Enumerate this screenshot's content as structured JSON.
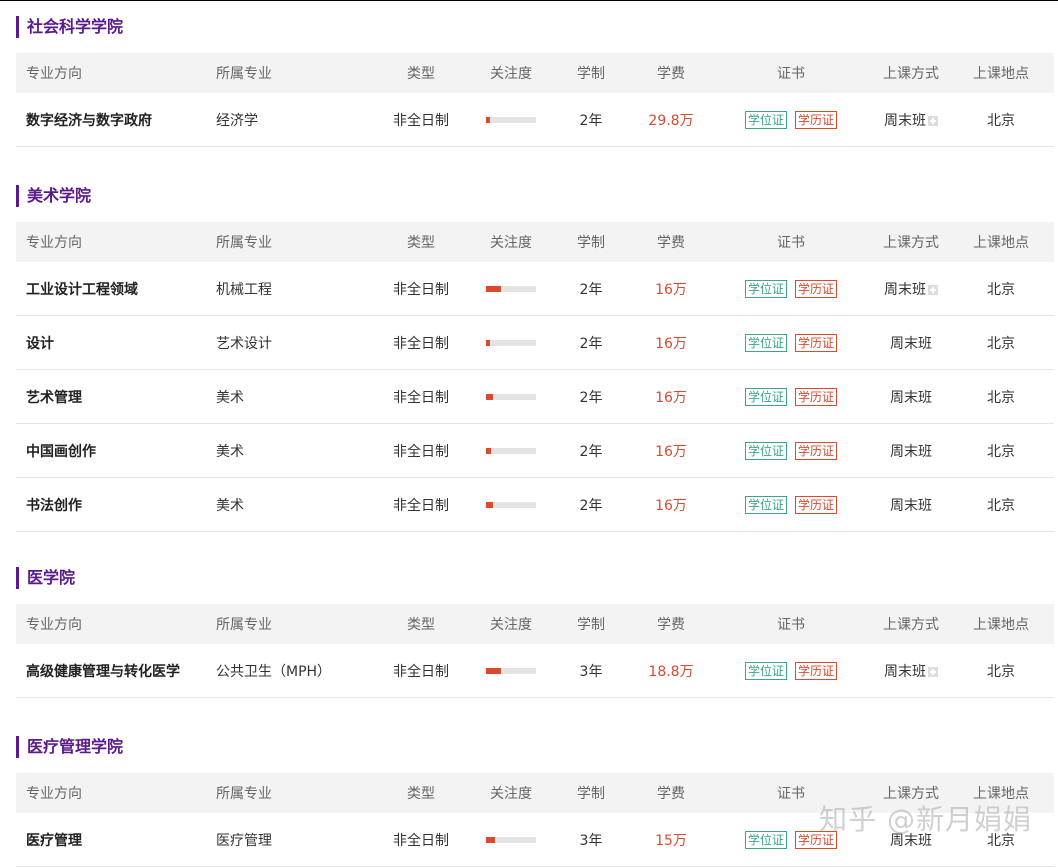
{
  "headers": [
    "专业方向",
    "所属专业",
    "类型",
    "关注度",
    "学制",
    "学费",
    "证书",
    "上课方式",
    "上课地点"
  ],
  "colors": {
    "accent": "#5b1a8c",
    "fee": "#d94a2f",
    "degree_tag": "#3aa68a",
    "diploma_tag": "#d94a2f",
    "attention_bar": "#d94a2f"
  },
  "sections": [
    {
      "title": "社会科学学院",
      "rows": [
        {
          "direction": "数字经济与数字政府",
          "major": "经济学",
          "type": "非全日制",
          "attention": 0.08,
          "duration": "2年",
          "fee": "29.8万",
          "cert_degree": "学位证",
          "cert_diploma": "学历证",
          "mode": "周末班",
          "mode_plus": true,
          "location": "北京"
        }
      ]
    },
    {
      "title": "美术学院",
      "rows": [
        {
          "direction": "工业设计工程领域",
          "major": "机械工程",
          "type": "非全日制",
          "attention": 0.3,
          "duration": "2年",
          "fee": "16万",
          "cert_degree": "学位证",
          "cert_diploma": "学历证",
          "mode": "周末班",
          "mode_plus": true,
          "location": "北京"
        },
        {
          "direction": "设计",
          "major": "艺术设计",
          "type": "非全日制",
          "attention": 0.08,
          "duration": "2年",
          "fee": "16万",
          "cert_degree": "学位证",
          "cert_diploma": "学历证",
          "mode": "周末班",
          "mode_plus": false,
          "location": "北京"
        },
        {
          "direction": "艺术管理",
          "major": "美术",
          "type": "非全日制",
          "attention": 0.14,
          "duration": "2年",
          "fee": "16万",
          "cert_degree": "学位证",
          "cert_diploma": "学历证",
          "mode": "周末班",
          "mode_plus": false,
          "location": "北京"
        },
        {
          "direction": "中国画创作",
          "major": "美术",
          "type": "非全日制",
          "attention": 0.1,
          "duration": "2年",
          "fee": "16万",
          "cert_degree": "学位证",
          "cert_diploma": "学历证",
          "mode": "周末班",
          "mode_plus": false,
          "location": "北京"
        },
        {
          "direction": "书法创作",
          "major": "美术",
          "type": "非全日制",
          "attention": 0.14,
          "duration": "2年",
          "fee": "16万",
          "cert_degree": "学位证",
          "cert_diploma": "学历证",
          "mode": "周末班",
          "mode_plus": false,
          "location": "北京"
        }
      ]
    },
    {
      "title": "医学院",
      "rows": [
        {
          "direction": "高级健康管理与转化医学",
          "major": "公共卫生（MPH）",
          "type": "非全日制",
          "attention": 0.3,
          "duration": "3年",
          "fee": "18.8万",
          "cert_degree": "学位证",
          "cert_diploma": "学历证",
          "mode": "周末班",
          "mode_plus": true,
          "location": "北京"
        }
      ]
    },
    {
      "title": "医疗管理学院",
      "rows": [
        {
          "direction": "医疗管理",
          "major": "医疗管理",
          "type": "非全日制",
          "attention": 0.18,
          "duration": "3年",
          "fee": "15万",
          "cert_degree": "学位证",
          "cert_diploma": "学历证",
          "mode": "周末班",
          "mode_plus": false,
          "location": "北京"
        }
      ]
    }
  ],
  "watermark": "知乎 @新月娟娟"
}
